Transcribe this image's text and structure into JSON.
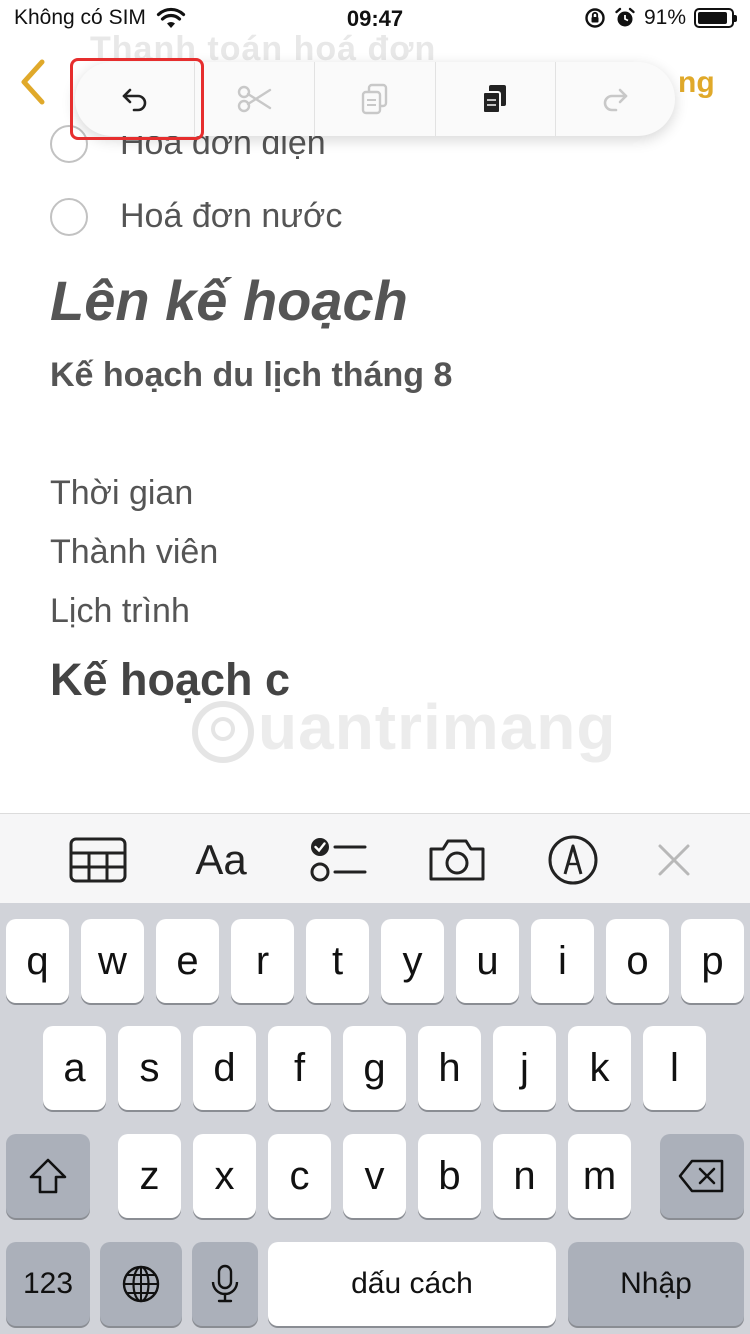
{
  "status_bar": {
    "carrier": "Không có SIM",
    "time": "09:47",
    "battery": "91%",
    "battery_level": 0.91
  },
  "nav": {
    "title": "Thanh toán hoá đơn",
    "right_label": "ng"
  },
  "edit_toolbar": {
    "buttons": [
      {
        "icon": "undo-icon",
        "state": "enabled"
      },
      {
        "icon": "scissors-icon",
        "state": "disabled"
      },
      {
        "icon": "copy-icon",
        "state": "disabled"
      },
      {
        "icon": "paste-icon",
        "state": "enabled"
      },
      {
        "icon": "redo-icon",
        "state": "disabled"
      }
    ],
    "highlight_color": "#e62e2e"
  },
  "note": {
    "checklist": [
      "Hoá đơn điện",
      "Hoá đơn nước"
    ],
    "heading": "Lên kế hoạch",
    "subheading": "Kế hoạch du lịch tháng 8",
    "lines": [
      "Thời gian",
      "Thành viên",
      "Lịch trình"
    ],
    "bold_line": "Kế hoạch c"
  },
  "watermark": "uantrimang",
  "accessory_toolbar": {
    "items": [
      "table-icon",
      "Aa",
      "checklist-icon",
      "camera-icon",
      "markup-icon",
      "close-icon"
    ]
  },
  "keyboard": {
    "row1": [
      "q",
      "w",
      "e",
      "r",
      "t",
      "y",
      "u",
      "i",
      "o",
      "p"
    ],
    "row2": [
      "a",
      "s",
      "d",
      "f",
      "g",
      "h",
      "j",
      "k",
      "l"
    ],
    "row3": [
      "z",
      "x",
      "c",
      "v",
      "b",
      "n",
      "m"
    ],
    "numbers_key": "123",
    "space_key": "dấu cách",
    "return_key": "Nhập"
  },
  "colors": {
    "accent": "#e0a92a",
    "keyboard_bg": "#d1d3d9",
    "key_dark": "#abb0ba"
  }
}
